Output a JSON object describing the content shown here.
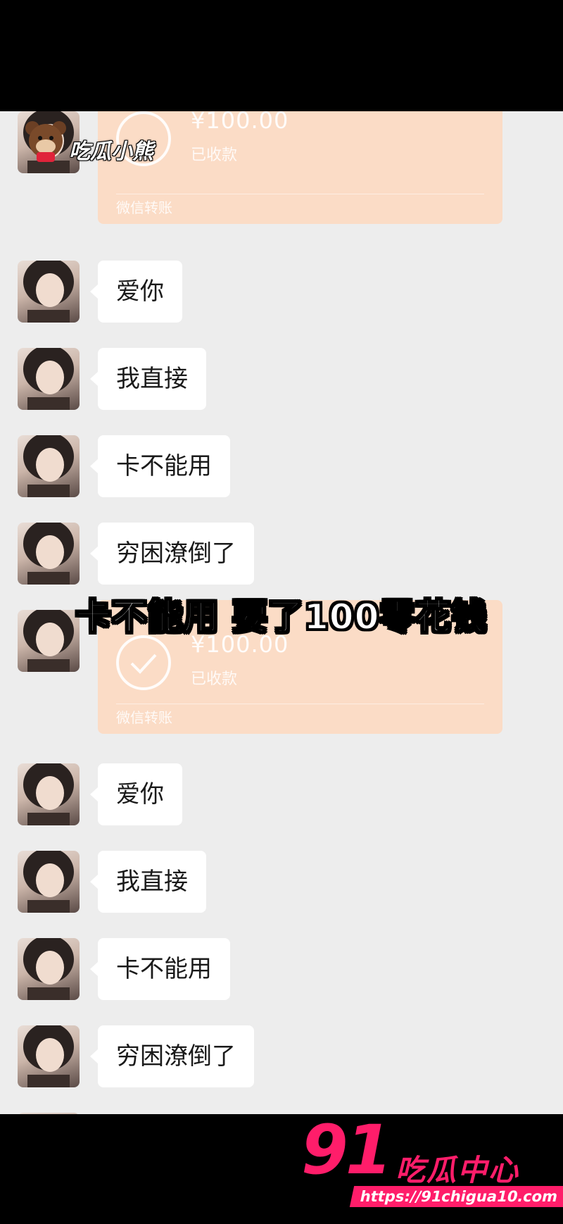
{
  "transfers": [
    {
      "amount": "¥100.00",
      "status": "已收款",
      "source": "微信转账"
    },
    {
      "amount": "¥100.00",
      "status": "已收款",
      "source": "微信转账"
    }
  ],
  "messages_group_1": [
    {
      "text": "爱你"
    },
    {
      "text": "我直接"
    },
    {
      "text": "卡不能用"
    },
    {
      "text": "穷困潦倒了"
    }
  ],
  "messages_group_2": [
    {
      "text": "爱你"
    },
    {
      "text": "我直接"
    },
    {
      "text": "卡不能用"
    },
    {
      "text": "穷困潦倒了"
    }
  ],
  "overlay": {
    "top_watermark": "吃瓜小熊",
    "caption": "卡不能用 要了100零花钱"
  },
  "brand": {
    "number": "91",
    "name": "吃瓜中心",
    "url": "https://91chigua10.com",
    "color": "#ff1d6a"
  },
  "colors": {
    "chat_background": "#ededed",
    "bubble": "#ffffff",
    "transfer_card": "#fbdcc6"
  }
}
